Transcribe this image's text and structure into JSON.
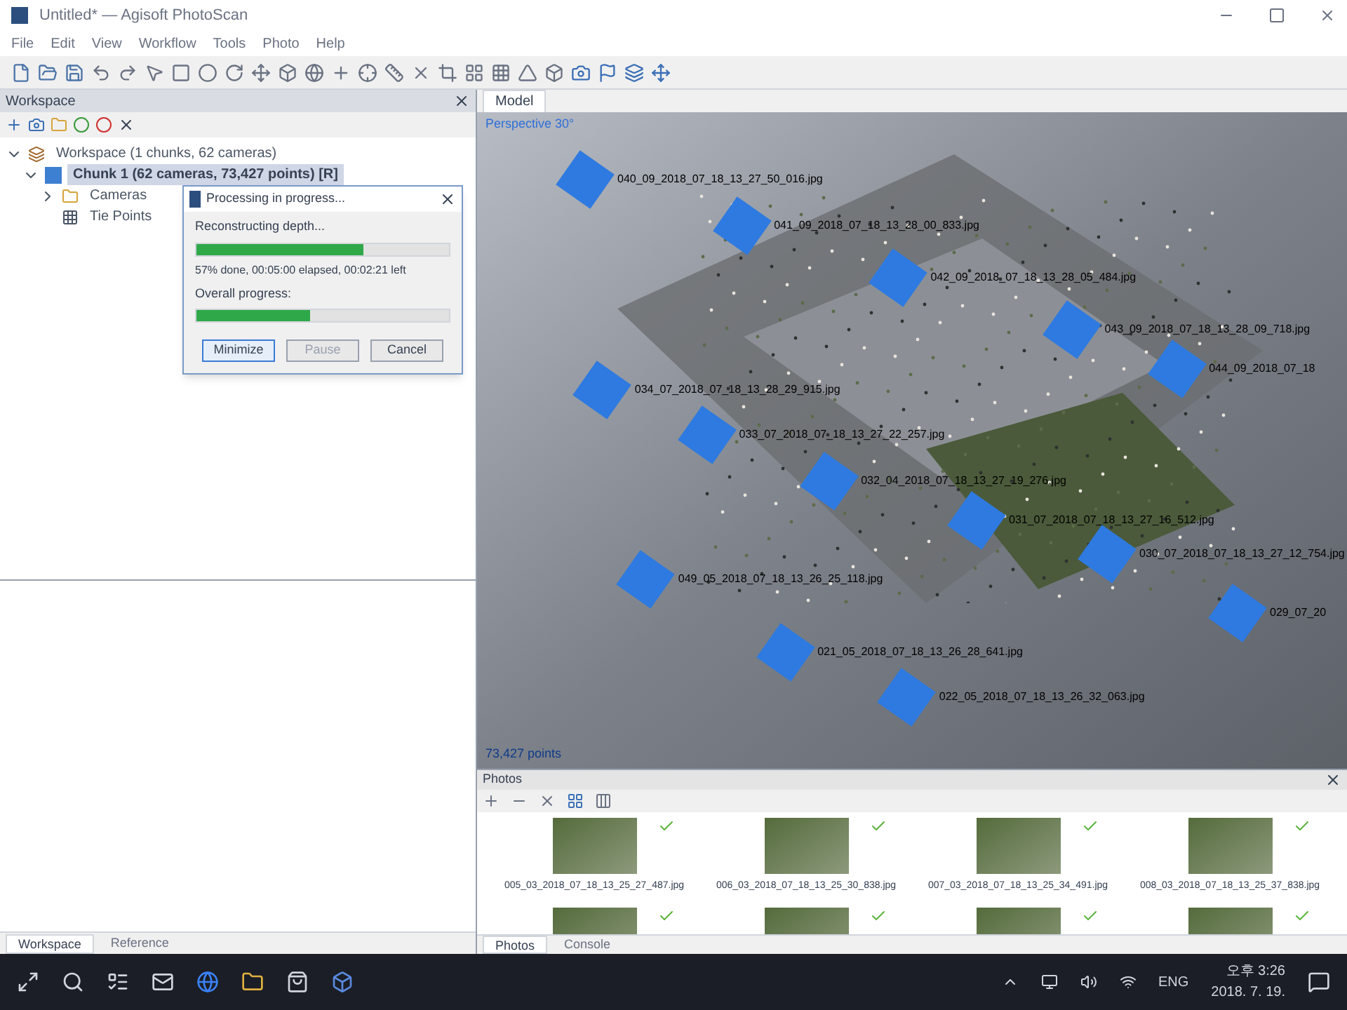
{
  "window": {
    "title": "Untitled* — Agisoft PhotoScan"
  },
  "menu": [
    "File",
    "Edit",
    "View",
    "Workflow",
    "Tools",
    "Photo",
    "Help"
  ],
  "workspace": {
    "title": "Workspace",
    "tree": [
      {
        "label": "Workspace (1 chunks, 62 cameras)",
        "expanded": true,
        "children": [
          {
            "label": "Chunk 1 (62 cameras, 73,427 points) [R]",
            "expanded": true,
            "selected": true,
            "children": [
              {
                "label": "Cameras",
                "expanded": false,
                "selected": false
              },
              {
                "label": "Tie Points",
                "selected": false
              }
            ]
          }
        ]
      }
    ],
    "tabs": [
      {
        "label": "Workspace",
        "selected": true
      },
      {
        "label": "Reference",
        "selected": false
      }
    ]
  },
  "dialog": {
    "title": "Processing in progress...",
    "steps": [
      {
        "label": "Reconstructing depth...",
        "level": 0.66,
        "status": "57% done, 00:05:00 elapsed, 00:02:21 left"
      },
      {
        "label": "Overall progress:",
        "level": 0.45
      }
    ],
    "buttons": [
      {
        "label": "Minimize",
        "disabled": false,
        "focused": true
      },
      {
        "label": "Pause",
        "disabled": true,
        "focused": false
      },
      {
        "label": "Cancel",
        "disabled": false,
        "focused": false
      }
    ]
  },
  "model": {
    "title": "Model",
    "view_label": "Perspective 30°",
    "points_label": "73,427 points",
    "cameras": [
      {
        "label": "040_09_2018_07_18_13_27_50_016.jpg"
      },
      {
        "label": "041_09_2018_07_18_13_28_00_833.jpg"
      },
      {
        "label": "042_09_2018_07_18_13_28_05_484.jpg"
      },
      {
        "label": "043_09_2018_07_18_13_28_09_718.jpg"
      },
      {
        "label": "044_09_2018_07_18"
      },
      {
        "label": "034_07_2018_07_18_13_28_29_915.jpg"
      },
      {
        "label": "033_07_2018_07_18_13_27_22_257.jpg"
      },
      {
        "label": "032_04_2018_07_18_13_27_19_276.jpg"
      },
      {
        "label": "031_07_2018_07_18_13_27_16_512.jpg"
      },
      {
        "label": "030_07_2018_07_18_13_27_12_754.jpg"
      },
      {
        "label": "049_05_2018_07_18_13_26_25_118.jpg"
      },
      {
        "label": "029_07_20"
      },
      {
        "label": "021_05_2018_07_18_13_26_28_641.jpg"
      },
      {
        "label": "022_05_2018_07_18_13_26_32_063.jpg"
      }
    ]
  },
  "photos": {
    "title": "Photos",
    "items": [
      {
        "label": "005_03_2018_07_18_13_25_27_487.jpg",
        "aligned": true
      },
      {
        "label": "006_03_2018_07_18_13_25_30_838.jpg",
        "aligned": true
      },
      {
        "label": "007_03_2018_07_18_13_25_34_491.jpg",
        "aligned": true
      },
      {
        "label": "008_03_2018_07_18_13_25_37_838.jpg",
        "aligned": true
      },
      {
        "aligned": true
      },
      {
        "aligned": true
      },
      {
        "aligned": true
      },
      {
        "aligned": true
      }
    ],
    "tabs": [
      {
        "label": "Photos",
        "selected": true
      },
      {
        "label": "Console",
        "selected": false
      }
    ]
  },
  "taskbar": {
    "language": "ENG",
    "time": "오후 3:26",
    "date": "2018. 7. 19."
  }
}
